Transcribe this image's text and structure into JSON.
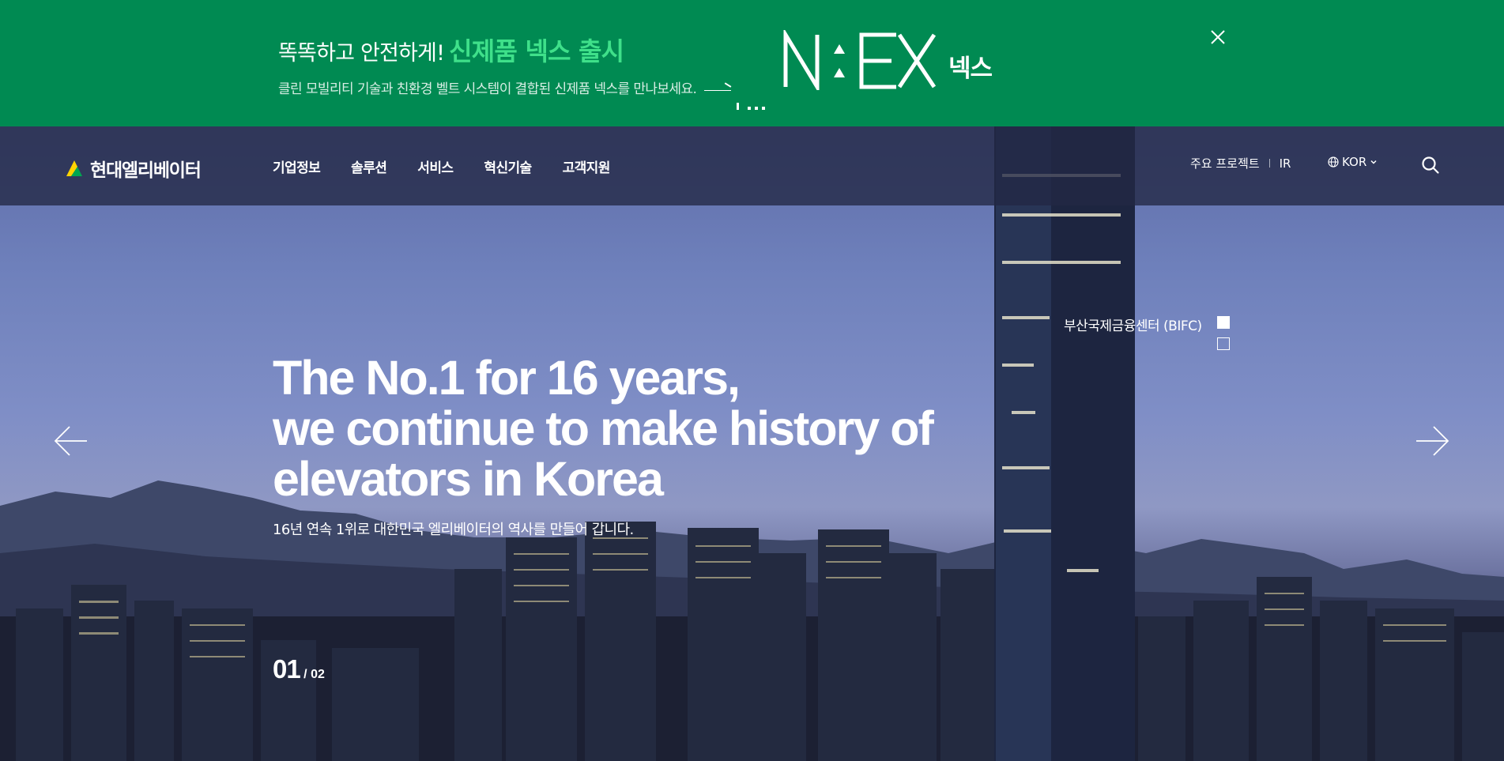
{
  "promo": {
    "headline": "똑똑하고 안전하게!",
    "headline_accent": "신제품 넥스 출시",
    "subtext": "클린 모빌리티 기술과 친환경 벨트 시스템이 결합된 신제품 넥스를 만나보세요.",
    "logo_text": "N:EX",
    "logo_korean": "넥스",
    "close_icon": "close-icon",
    "background_color": "#008a52",
    "accent_color": "#3fe08a"
  },
  "nav": {
    "logo_text": "현대엘리베이터",
    "menu": [
      "기업정보",
      "솔루션",
      "서비스",
      "혁신기술",
      "고객지원"
    ],
    "util_links": [
      "주요 프로젝트",
      "IR"
    ],
    "language": "KOR",
    "icons": [
      "globe-icon",
      "chevron-down-icon",
      "search-icon"
    ]
  },
  "hero": {
    "headline_lines": [
      "The No.1 for 16 years,",
      "we continue to make history of",
      "elevators in Korea"
    ],
    "subline": "16년 연속 1위로 대한민국 엘리베이터의 역사를 만들어 갑니다.",
    "project_label": "부산국제금융센터 (BIFC)",
    "counter_current": "01",
    "counter_total": "/ 02",
    "active_slide": 1,
    "slide_count": 2,
    "icons": [
      "arrow-left-icon",
      "arrow-right-icon"
    ]
  }
}
